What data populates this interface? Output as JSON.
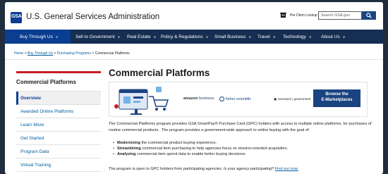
{
  "header": {
    "logo_text": "GSA",
    "site_title": "U.S. General Services Administration",
    "per_diem_label": "Per Diem Lookup",
    "search_placeholder": "Search GSA.gov"
  },
  "nav": {
    "items": [
      {
        "label": "Buy Through Us"
      },
      {
        "label": "Sell to Government"
      },
      {
        "label": "Real Estate"
      },
      {
        "label": "Policy & Regulations"
      },
      {
        "label": "Small Business"
      },
      {
        "label": "Travel"
      },
      {
        "label": "Technology"
      },
      {
        "label": "About Us"
      }
    ]
  },
  "breadcrumb": {
    "home": "Home",
    "sep": ">",
    "buy": "Buy Through Us",
    "purchasing": "Purchasing Programs",
    "current": "Commercial Platforms"
  },
  "sidebar": {
    "heading": "Commercial Platforms",
    "items": [
      {
        "label": "Overview"
      },
      {
        "label": "Awarded Online Platforms"
      },
      {
        "label": "Learn More"
      },
      {
        "label": "Get Started"
      },
      {
        "label": "Program Data"
      },
      {
        "label": "Virtual Training"
      }
    ]
  },
  "main": {
    "title": "Commercial Platforms",
    "banner": {
      "amazon": "amazon",
      "amazon_suffix": "business",
      "fisher": "fisher scientific",
      "overstock": "overstock",
      "government": "government",
      "browse_line1": "Browse the",
      "browse_line2": "E-Marketplaces"
    },
    "intro": "The Commercial Platforms program provides GSA SmartPay® Purchase Card (GPC) holders with access to multiple online platforms, for purchases of routine commercial products . The program provides a government-wide approach to online buying with the goal of:",
    "bullets": [
      {
        "bold": "Modernizing",
        "rest": " the commercial product buying experience."
      },
      {
        "bold": "Streamlining",
        "rest": " commercial item purchasing to help agencies focus on mission-oriented acquisition."
      },
      {
        "bold": "Analyzing",
        "rest": " commercial item spend data to enable better buying decisions."
      }
    ],
    "closing_text": "The program is open to GPC holders from participating agencies. ",
    "closing_question": "Is your agency participating?",
    "closing_link": "Find out now."
  },
  "colors": {
    "nav_bg": "#162e51",
    "accent_blue": "#1a4480",
    "sidebar_accent": "#c81d25",
    "link": "#005ea2"
  }
}
